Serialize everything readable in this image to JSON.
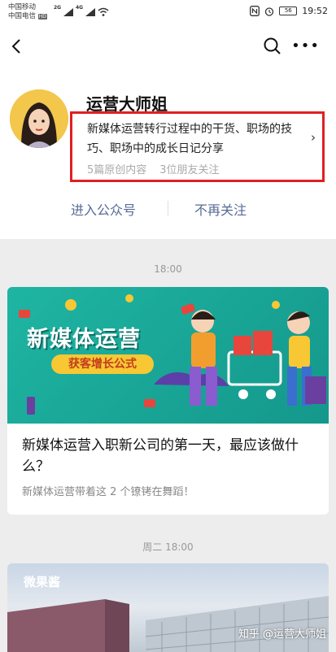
{
  "status": {
    "carrier1": "中国移动",
    "carrier2": "中国电信",
    "hd": "HD",
    "net1": "2G",
    "net2": "4G",
    "battery": "56",
    "time": "19:52"
  },
  "account": {
    "name": "运营大师姐",
    "description": "新媒体运营转行过程中的干货、职场的技巧、职场中的成长日记分享",
    "originals": "5篇原创内容",
    "friends_following": "3位朋友关注",
    "enter_label": "进入公众号",
    "unfollow_label": "不再关注"
  },
  "feed": {
    "time1": "18:00",
    "article1": {
      "banner_title": "新媒体运营",
      "banner_tag": "获客增长公式",
      "title": "新媒体运营入职新公司的第一天，最应该做什么？",
      "subtitle": "新媒体运营带着这 2 个镣铐在舞蹈！"
    },
    "time2": "周二 18:00",
    "article2": {
      "logo_text": "微果酱"
    }
  },
  "watermark": "知乎 @运营大师姐",
  "colors": {
    "link": "#576b95",
    "highlight_border": "#e02020",
    "banner_bg": "#1fb5a3"
  }
}
